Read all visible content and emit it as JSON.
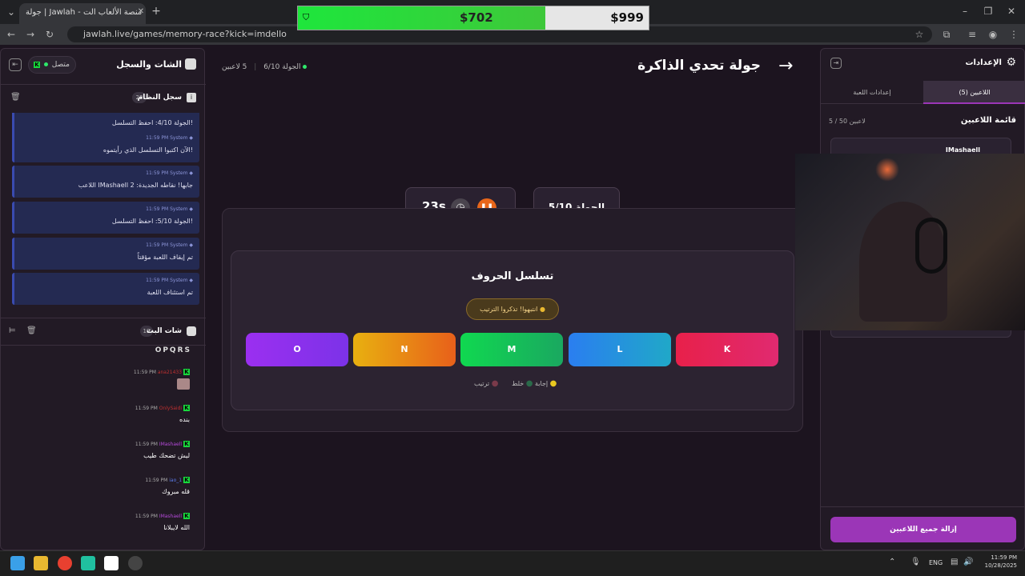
{
  "browser": {
    "tab_title": "جولة | Jawlah - منصة الألعاب الت",
    "url": "jawlah.live/games/memory-race?kick=imdello"
  },
  "overlay": {
    "left_amount": "$702",
    "right_amount": "$999",
    "fill_fraction": 0.705
  },
  "left_panel": {
    "title": "الشات والسجل",
    "status": "متصل",
    "log": {
      "title": "سجل النظام",
      "count": "23",
      "entries": [
        {
          "time": "11:59 PM",
          "sender": "System",
          "text": "الجولة 4/10: احفظ التسلسل!"
        },
        {
          "time": "11:59 PM",
          "sender": "System",
          "text": "الآن اكتبوا التسلسل الذي رأيتموه!"
        },
        {
          "time": "11:59 PM",
          "sender": "System",
          "text": "اللاعب IMashaell جابها! نقاطه الجديدة: 2"
        },
        {
          "time": "11:59 PM",
          "sender": "System",
          "text": "الجولة 5/10: احفظ التسلسل!"
        },
        {
          "time": "11:59 PM",
          "sender": "System",
          "text": "تم إيقاف اللعبة مؤقتاً"
        },
        {
          "time": "11:59 PM",
          "sender": "System",
          "text": "تم استئناف اللعبة"
        }
      ]
    },
    "chat": {
      "title": "شات البث",
      "count": "19",
      "top_text": "OPQRS",
      "messages": [
        {
          "time": "11:59 PM",
          "user": "ana21433",
          "text": ""
        },
        {
          "time": "11:59 PM",
          "user": "OnlySaidi",
          "text": "بنده"
        },
        {
          "time": "11:59 PM",
          "user": "IMashaell",
          "text": "ليش تضحك طيب"
        },
        {
          "time": "11:59 PM",
          "user": "iao_1",
          "text": "قله مبروك"
        },
        {
          "time": "11:59 PM",
          "user": "IMashaell",
          "text": "الله لايبلانا"
        }
      ]
    }
  },
  "main": {
    "title": "جولة تحدي الذاكرة",
    "players_count": "5 لاعبين",
    "round_label": "الجولة 6/10",
    "timer": "23s",
    "round_box": "الجولة 5/10",
    "game_title": "تسلسل الحروف",
    "hint": "انتبهوا! تذكروا الترتيب",
    "letters": [
      "O",
      "N",
      "M",
      "L",
      "K"
    ],
    "legend": [
      "ترتيب",
      "خلط",
      "إجابة"
    ]
  },
  "right_panel": {
    "title": "الإعدادات",
    "tab_players": "اللاعبين (5)",
    "tab_settings": "إعدادات اللعبة",
    "list_title": "قائمة اللاعبين",
    "list_count": "5 / 50 لاعبين",
    "first_player": "IMashaell",
    "remove_all": "إزالة جميع اللاعبين"
  },
  "taskbar": {
    "lang": "ENG",
    "time": "11:59 PM",
    "date": "10/28/2025"
  },
  "colors": {
    "accent_purple": "#9b36b7",
    "tile_O": "#9b2ff0",
    "tile_N": "#e88a10",
    "tile_M": "#15c45a",
    "tile_L": "#2a8de8",
    "tile_K": "#e8205a"
  }
}
